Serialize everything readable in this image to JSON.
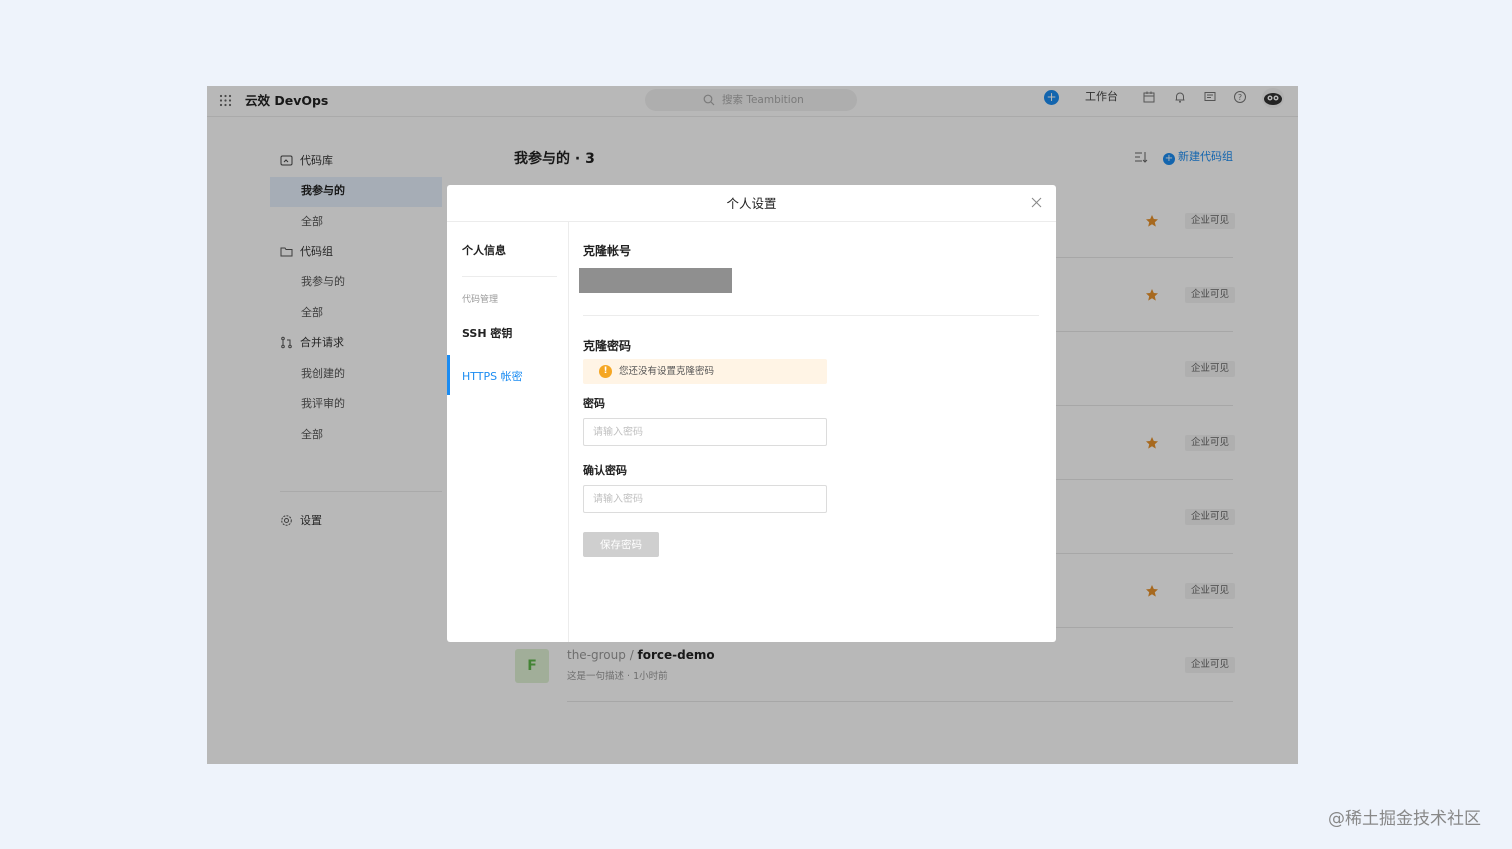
{
  "app": {
    "brand": "云效 DevOps",
    "search_placeholder": "搜索 Teambition",
    "workbench_label": "工作台"
  },
  "sidebar": {
    "repo_section": "代码库",
    "repo_items": [
      "我参与的",
      "全部"
    ],
    "group_section": "代码组",
    "group_items": [
      "我参与的",
      "全部"
    ],
    "mr_section": "合并请求",
    "mr_items": [
      "我创建的",
      "我评审的",
      "全部"
    ],
    "settings": "设置"
  },
  "main": {
    "title": "我参与的 · 3",
    "new_repo": "新建代码组",
    "repos": [
      {
        "starred": true,
        "visibility": "企业可见"
      },
      {
        "starred": true,
        "visibility": "企业可见"
      },
      {
        "starred": false,
        "visibility": "企业可见"
      },
      {
        "starred": true,
        "visibility": "企业可见"
      },
      {
        "starred": false,
        "visibility": "企业可见"
      },
      {
        "starred": true,
        "visibility": "企业可见"
      },
      {
        "starred": false,
        "visibility": "企业可见",
        "avatar": "F",
        "group": "the-group",
        "name": "force-demo",
        "desc": "这是一句描述",
        "time": "1小时前"
      }
    ]
  },
  "modal": {
    "title": "个人设置",
    "nav": {
      "profile": "个人信息",
      "group_label": "代码管理",
      "ssh": "SSH 密钥",
      "https": "HTTPS 帐密"
    },
    "clone_account_title": "克隆帐号",
    "clone_password_title": "克隆密码",
    "warning": "您还没有设置克隆密码",
    "password_label": "密码",
    "password_placeholder": "请输入密码",
    "confirm_label": "确认密码",
    "confirm_placeholder": "请输入密码",
    "save_button": "保存密码"
  },
  "watermark": "@稀土掘金技术社区",
  "colors": {
    "accent": "#1b8cf2",
    "warning": "#f5a623",
    "star": "#e8922b"
  }
}
